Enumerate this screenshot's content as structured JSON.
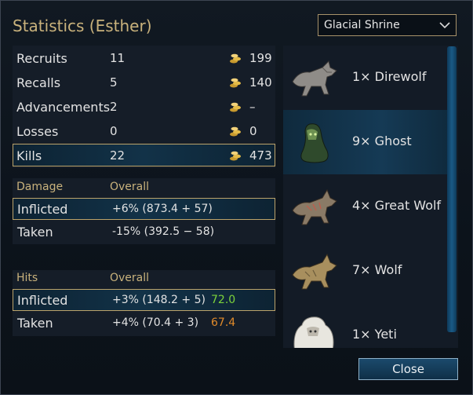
{
  "window": {
    "title": "Statistics (Esther)"
  },
  "scenario_select": {
    "value": "Glacial Shrine"
  },
  "summary_rows": [
    {
      "label": "Recruits",
      "value": "11",
      "gold": "199",
      "highlight": false
    },
    {
      "label": "Recalls",
      "value": "5",
      "gold": "140",
      "highlight": false
    },
    {
      "label": "Advancements",
      "value": "2",
      "gold": "–",
      "highlight": false
    },
    {
      "label": "Losses",
      "value": "0",
      "gold": "0",
      "highlight": false
    },
    {
      "label": "Kills",
      "value": "22",
      "gold": "473",
      "highlight": true
    }
  ],
  "damage": {
    "header": "Damage",
    "header_col": "Overall",
    "inflicted": {
      "label": "Inflicted",
      "value": "+6% (873.4 + 57)"
    },
    "taken": {
      "label": "Taken",
      "value": "-15% (392.5 − 58)"
    }
  },
  "hits": {
    "header": "Hits",
    "header_col": "Overall",
    "inflicted": {
      "label": "Inflicted",
      "value": "+3% (148.2 + 5)",
      "extra": "72.0",
      "extra_color": "#7cd33a"
    },
    "taken": {
      "label": "Taken",
      "value": "+4% (70.4 + 3)",
      "extra": "67.4",
      "extra_color": "#e08a2a"
    }
  },
  "units": [
    {
      "name": "1× Direwolf",
      "icon": "direwolf-icon",
      "selected": false
    },
    {
      "name": "9× Ghost",
      "icon": "ghost-icon",
      "selected": true
    },
    {
      "name": "4× Great Wolf",
      "icon": "great-wolf-icon",
      "selected": false
    },
    {
      "name": "7× Wolf",
      "icon": "wolf-icon",
      "selected": false
    },
    {
      "name": "1× Yeti",
      "icon": "yeti-icon",
      "selected": false
    }
  ],
  "buttons": {
    "close": "Close"
  },
  "colors": {
    "gold": "#c9b27c",
    "highlight_border": "#bba36a"
  }
}
